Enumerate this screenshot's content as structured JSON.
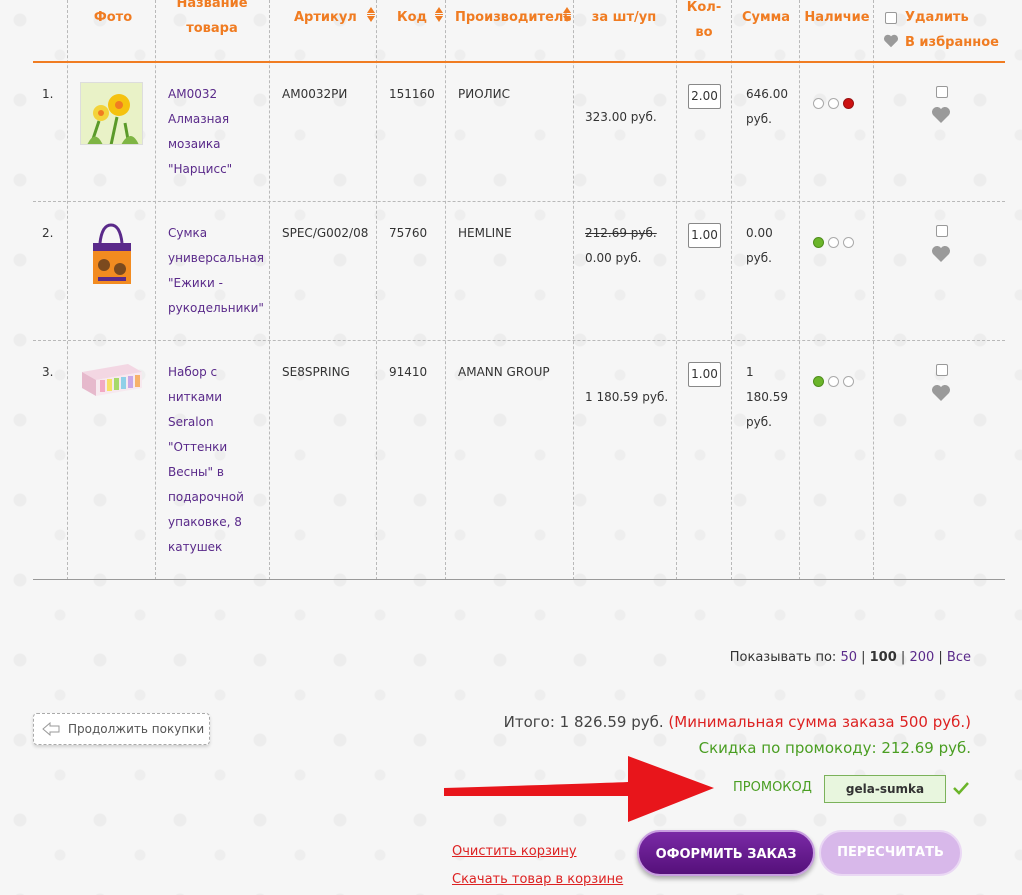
{
  "table": {
    "headers": {
      "photo": "Фото",
      "name": "Название товара",
      "article": "Артикул",
      "code": "Код",
      "manufacturer": "Производитель",
      "price": "за шт/уп",
      "qty": "Кол-во",
      "sum": "Сумма",
      "availability": "Наличие",
      "delete": "Удалить",
      "favorites": "В избранное"
    },
    "rows": [
      {
        "num": "1.",
        "name": "АМ0032 Алмазная мозаика \"Нарцисс\"",
        "article": "АМ0032РИ",
        "code": "151160",
        "manufacturer": "РИОЛИС",
        "old_price": "",
        "price": "323.00 руб.",
        "qty": "2.00",
        "sum": "646.00 руб.",
        "availability": "low"
      },
      {
        "num": "2.",
        "name": "Сумка универсальная \"Ежики - рукодельники\"",
        "article": "SPEC/G002/08",
        "code": "75760",
        "manufacturer": "HEMLINE",
        "old_price": "212.69 руб.",
        "price": "0.00 руб.",
        "qty": "1.00",
        "sum": "0.00 руб.",
        "availability": "high"
      },
      {
        "num": "3.",
        "name": "Набор с нитками Seralon \"Оттенки Весны\" в подарочной упаковке, 8 катушек",
        "article": "SE8SPRING",
        "code": "91410",
        "manufacturer": "AMANN GROUP",
        "old_price": "",
        "price": "1 180.59 руб.",
        "qty": "1.00",
        "sum": "1 180.59 руб.",
        "availability": "high"
      }
    ]
  },
  "per_page": {
    "label": "Показывать по:",
    "opt1": "50",
    "opt2": "100",
    "opt3": "200",
    "opt4": "Все"
  },
  "continue_label": "Продолжить покупки",
  "summary": {
    "total": "Итого: 1 826.59 руб.",
    "min_order": "(Минимальная сумма заказа 500 руб.)",
    "discount": "Скидка по промокоду: 212.69 руб."
  },
  "promo": {
    "label": "ПРОМОКОД",
    "value": "gela-sumka"
  },
  "links": {
    "clear": "Очистить корзину",
    "download": "Скачать товар в корзине"
  },
  "buttons": {
    "order": "ОФОРМИТЬ ЗАКАЗ",
    "recalc": "ПЕРЕСЧИТАТЬ"
  },
  "colors": {
    "accent": "#f07c22",
    "link": "#5a2a8a",
    "order_button": "#6a1d94",
    "discount": "#4a9e22",
    "warning": "#dd2222"
  }
}
